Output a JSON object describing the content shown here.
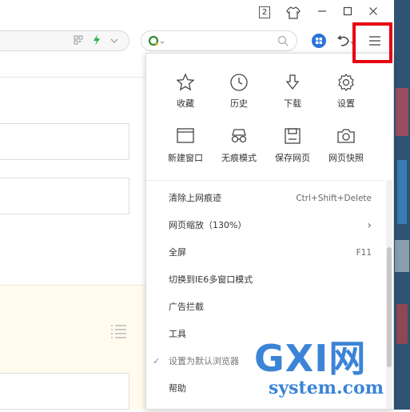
{
  "titlebar": {
    "tab_count": "2",
    "shirt_icon": "tshirt-icon",
    "minimize_icon": "minimize-icon",
    "maximize_icon": "maximize-icon",
    "close_icon": "close-icon"
  },
  "toolbar": {
    "search_placeholder": "",
    "undo_icon": "undo-icon",
    "menu_icon": "hamburger-menu-icon"
  },
  "quick_actions": [
    {
      "label": "收藏",
      "icon": "star-icon"
    },
    {
      "label": "历史",
      "icon": "clock-icon"
    },
    {
      "label": "下载",
      "icon": "download-icon"
    },
    {
      "label": "设置",
      "icon": "gear-icon"
    },
    {
      "label": "新建窗口",
      "icon": "new-window-icon"
    },
    {
      "label": "无痕模式",
      "icon": "glasses-icon"
    },
    {
      "label": "保存网页",
      "icon": "save-icon"
    },
    {
      "label": "网页快照",
      "icon": "camera-icon"
    }
  ],
  "menu_items": [
    {
      "label": "清除上网痕迹",
      "shortcut": "Ctrl+Shift+Delete"
    },
    {
      "label": "网页缩放（130%）",
      "shortcut": "›"
    },
    {
      "label": "全屏",
      "shortcut": "F11"
    },
    {
      "label": "切换到IE6多窗口模式",
      "shortcut": ""
    },
    {
      "label": "广告拦截",
      "shortcut": ""
    },
    {
      "label": "工具",
      "shortcut": ""
    },
    {
      "label": "设置为默认浏览器",
      "shortcut": ""
    },
    {
      "label": "帮助",
      "shortcut": ""
    }
  ],
  "watermark": {
    "brand": "GXI网",
    "domain": "system.com"
  },
  "colors": {
    "highlight": "#e60012",
    "accent": "#2e8b2e",
    "watermark": "#1a6fd0"
  }
}
